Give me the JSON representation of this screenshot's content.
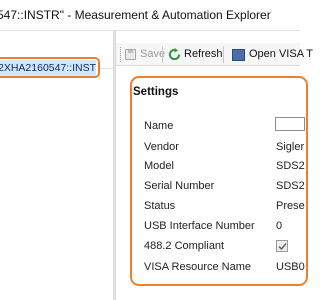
{
  "window": {
    "title": "547::INSTR\" - Measurement & Automation Explorer"
  },
  "tree": {
    "selected_label": "2XHA2160547::INSTR\""
  },
  "toolbar": {
    "save_label": "Save",
    "refresh_label": "Refresh",
    "open_visa_label": "Open VISA T"
  },
  "settings": {
    "heading": "Settings",
    "rows": [
      {
        "label": "Name",
        "value": ""
      },
      {
        "label": "Vendor",
        "value": "Sigler"
      },
      {
        "label": "Model",
        "value": "SDS2"
      },
      {
        "label": "Serial Number",
        "value": "SDS2"
      },
      {
        "label": "Status",
        "value": "Prese"
      },
      {
        "label": "USB Interface Number",
        "value": "0"
      },
      {
        "label": "488.2 Compliant",
        "value": "checked"
      },
      {
        "label": "VISA Resource Name",
        "value": "USB0"
      }
    ]
  },
  "colors": {
    "highlight_border": "#ef7f2b",
    "selection_bg": "#d4e6fa",
    "refresh_icon": "#2e9a3a"
  }
}
